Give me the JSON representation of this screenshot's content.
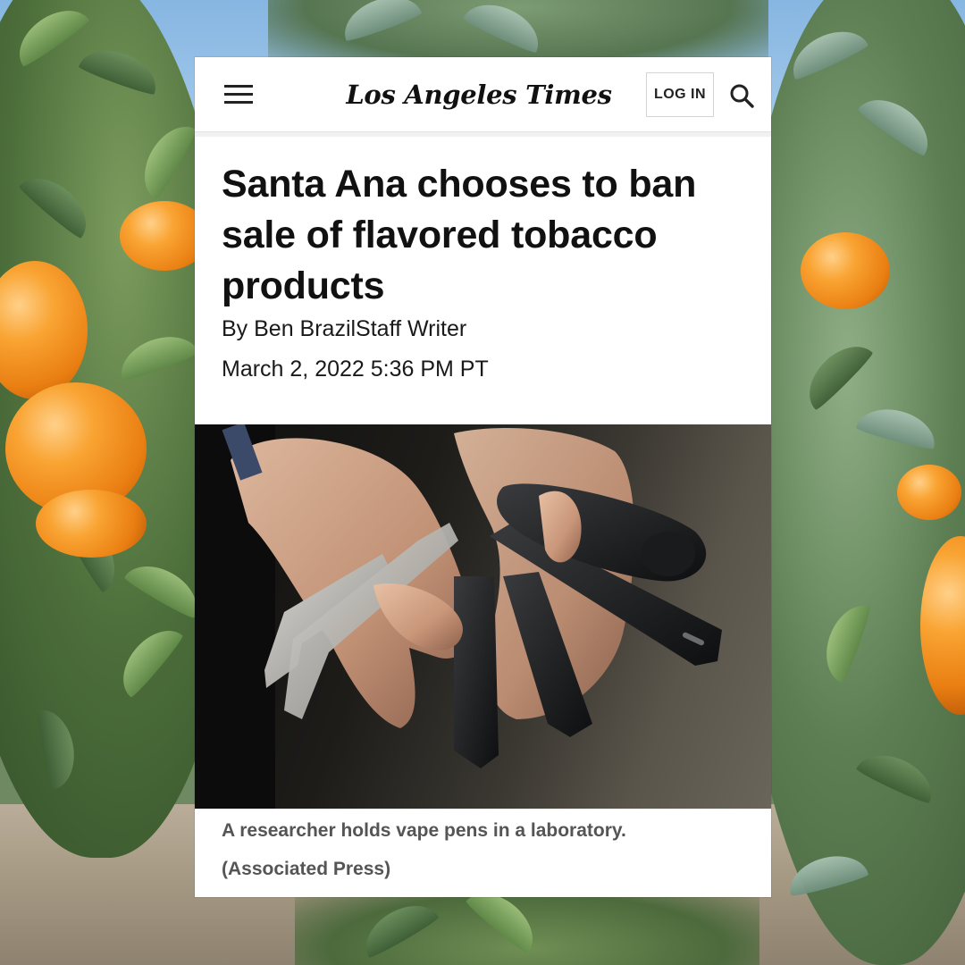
{
  "site": {
    "logo_text": "Los Angeles Times",
    "login_label": "LOG IN"
  },
  "article": {
    "headline": "Santa Ana chooses to ban sale of flavored tobacco products",
    "byline": "By Ben BrazilStaff Writer",
    "date": "March 2, 2022 5:36 PM PT",
    "caption": "A researcher holds vape pens in a laboratory.",
    "credit": "(Associated Press)"
  },
  "icons": {
    "menu": "hamburger-menu-icon",
    "search": "search-icon"
  },
  "colors": {
    "card_background": "#ffffff",
    "headline_text": "#111111",
    "caption_text": "#555555"
  }
}
